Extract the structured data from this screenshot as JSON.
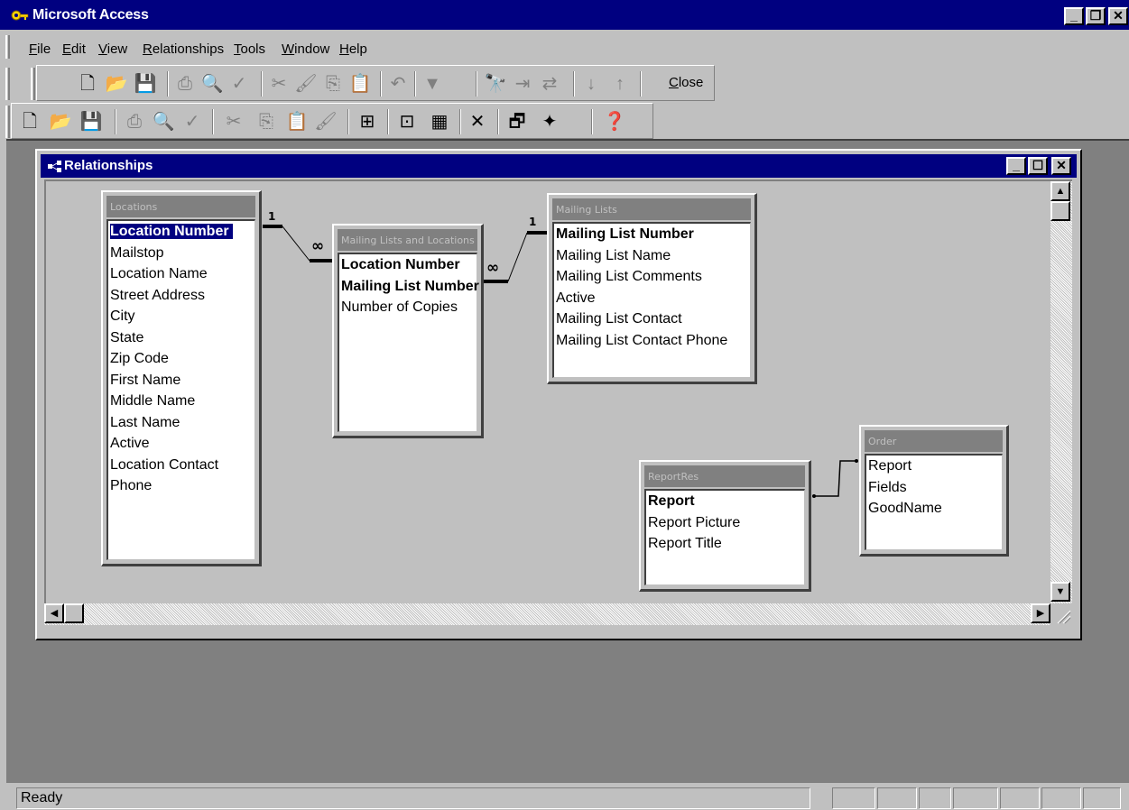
{
  "app": {
    "title": "Microsoft Access",
    "controls": {
      "minimize": "_",
      "restore": "❐",
      "close": "✕"
    }
  },
  "menubar": {
    "items": [
      {
        "label": "File",
        "accel": "F",
        "rest": "ile"
      },
      {
        "label": "Edit",
        "accel": "E",
        "rest": "dit"
      },
      {
        "label": "View",
        "accel": "V",
        "rest": "iew"
      },
      {
        "label": "Relationships",
        "accel": "R",
        "rest": "elationships"
      },
      {
        "label": "Tools",
        "accel": "T",
        "rest": "ools"
      },
      {
        "label": "Window",
        "accel": "W",
        "rest": "indow"
      },
      {
        "label": "Help",
        "accel": "H",
        "rest": "elp"
      }
    ]
  },
  "toolbar1": {
    "close_label": "Close",
    "close_accel": "C",
    "close_rest": "lose"
  },
  "relationships_window": {
    "title": "Relationships",
    "controls": {
      "minimize": "_",
      "maximize": "☐",
      "close": "✕"
    }
  },
  "tables": {
    "locations": {
      "title": "Locations",
      "fields": [
        "Location Number",
        "Mailstop",
        "Location Name",
        "Street Address",
        "City",
        "State",
        "Zip Code",
        "First Name",
        "Middle Name",
        "Last Name",
        "Active",
        "Location Contact",
        "Phone"
      ]
    },
    "mailing_lists_and_locations": {
      "title": "Mailing Lists and Locations",
      "fields": [
        "Location Number",
        "Mailing List Number",
        "Number of Copies"
      ]
    },
    "mailing_lists": {
      "title": "Mailing Lists",
      "fields": [
        "Mailing List Number",
        "Mailing List Name",
        "Mailing List Comments",
        "Active",
        "Mailing List Contact",
        "Mailing List Contact Phone"
      ]
    },
    "report_res": {
      "title": "ReportRes",
      "fields": [
        "Report",
        "Report Picture",
        "Report Title"
      ]
    },
    "order": {
      "title": "Order",
      "fields": [
        "Report",
        "Fields",
        "GoodName"
      ]
    }
  },
  "relationships": {
    "one_label": "1",
    "many_label": "∞"
  },
  "status": {
    "text": "Ready"
  },
  "colors": {
    "title_bar": "#000080",
    "face": "#c0c0c0",
    "mdi_background": "#808080",
    "field_list_caption": "#808080",
    "selection": "#000080"
  }
}
